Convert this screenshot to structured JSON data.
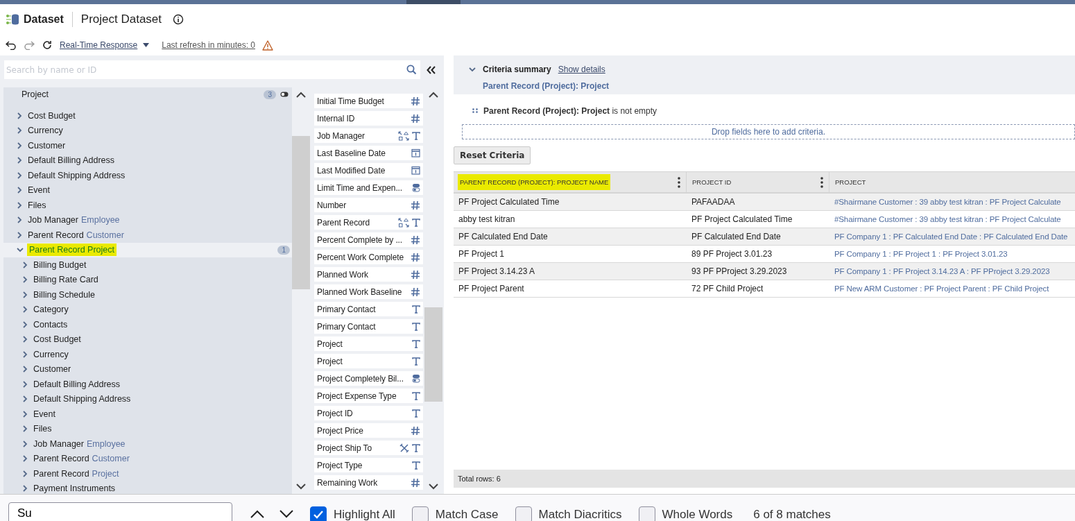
{
  "header": {
    "app": "Dataset",
    "title": "Project Dataset"
  },
  "toolbar": {
    "undo_disabled": false,
    "redo_disabled": true,
    "mode": "Real-Time Response",
    "refresh": "Last refresh in minutes: 0"
  },
  "search": {
    "placeholder": "Search by name or ID"
  },
  "tree": {
    "title": "Project",
    "count": "3",
    "items": [
      {
        "label": "Cost Budget",
        "expanded": false,
        "selected": false
      },
      {
        "label": "Currency",
        "expanded": false,
        "selected": false
      },
      {
        "label": "Customer",
        "expanded": false,
        "selected": false
      },
      {
        "label": "Default Billing Address",
        "expanded": false,
        "selected": false
      },
      {
        "label": "Default Shipping Address",
        "expanded": false,
        "selected": false
      },
      {
        "label": "Event",
        "expanded": false,
        "selected": false
      },
      {
        "label": "Files",
        "expanded": false,
        "selected": false
      },
      {
        "label": "Job Manager",
        "sublabel": "Employee",
        "expanded": false,
        "selected": false
      },
      {
        "label": "Parent Record",
        "sublabel": "Customer",
        "expanded": false,
        "selected": false
      },
      {
        "label": "Parent Record Project",
        "count": "1",
        "highlighted": true,
        "expanded": true,
        "selected": true,
        "children": [
          {
            "label": "Billing Budget",
            "expanded": false,
            "selected": false
          },
          {
            "label": "Billing Rate Card",
            "expanded": false,
            "selected": false
          },
          {
            "label": "Billing Schedule",
            "expanded": false,
            "selected": false
          },
          {
            "label": "Category",
            "expanded": false,
            "selected": false
          },
          {
            "label": "Contacts",
            "expanded": false,
            "selected": false
          },
          {
            "label": "Cost Budget",
            "expanded": false,
            "selected": false
          },
          {
            "label": "Currency",
            "expanded": false,
            "selected": false
          },
          {
            "label": "Customer",
            "expanded": false,
            "selected": false
          },
          {
            "label": "Default Billing Address",
            "expanded": false,
            "selected": false
          },
          {
            "label": "Default Shipping Address",
            "expanded": false,
            "selected": false
          },
          {
            "label": "Event",
            "expanded": false,
            "selected": false
          },
          {
            "label": "Files",
            "expanded": false,
            "selected": false
          },
          {
            "label": "Job Manager",
            "sublabel": "Employee",
            "expanded": false,
            "selected": false
          },
          {
            "label": "Parent Record",
            "sublabel": "Customer",
            "expanded": false,
            "selected": false
          },
          {
            "label": "Parent Record",
            "sublabel": "Project",
            "expanded": false,
            "selected": false
          },
          {
            "label": "Payment Instruments",
            "expanded": false,
            "selected": false
          }
        ]
      }
    ]
  },
  "fields": [
    {
      "label": "Initial Time Budget",
      "kind": "number"
    },
    {
      "label": "Internal ID",
      "kind": "number"
    },
    {
      "label": "Job Manager",
      "kind": "reference"
    },
    {
      "label": "Last Baseline Date",
      "kind": "date"
    },
    {
      "label": "Last Modified Date",
      "kind": "date"
    },
    {
      "label": "Limit Time and Expen...",
      "kind": "boolean"
    },
    {
      "label": "Number",
      "kind": "number"
    },
    {
      "label": "Parent Record",
      "kind": "reference"
    },
    {
      "label": "Percent Complete by ...",
      "kind": "number"
    },
    {
      "label": "Percent Work Complete",
      "kind": "number"
    },
    {
      "label": "Planned Work",
      "kind": "number"
    },
    {
      "label": "Planned Work Baseline",
      "kind": "number"
    },
    {
      "label": "Primary Contact",
      "kind": "text"
    },
    {
      "label": "Primary Contact",
      "kind": "text"
    },
    {
      "label": "Project",
      "kind": "text"
    },
    {
      "label": "Project",
      "kind": "text"
    },
    {
      "label": "Project Completely Bil...",
      "kind": "boolean"
    },
    {
      "label": "Project Expense Type",
      "kind": "text"
    },
    {
      "label": "Project ID",
      "kind": "text"
    },
    {
      "label": "Project Price",
      "kind": "number"
    },
    {
      "label": "Project Ship To",
      "kind": "address"
    },
    {
      "label": "Project Type",
      "kind": "text"
    },
    {
      "label": "Remaining Work",
      "kind": "number"
    }
  ],
  "criteria": {
    "title": "Criteria summary",
    "expanded": true,
    "details_link": "Show details",
    "summary": "Parent Record (Project): Project",
    "conditions": [
      "**Parent Record (Project): Project** is not empty"
    ],
    "drop_hint": "Drop fields here to add criteria.",
    "reset": "Reset Criteria"
  },
  "table": {
    "columns": [
      {
        "label": "PARENT RECORD (PROJECT): PROJECT NAME",
        "highlighted": true,
        "menu": true,
        "link": false
      },
      {
        "label": "PROJECT ID",
        "highlighted": false,
        "menu": true,
        "link": false
      },
      {
        "label": "PROJECT",
        "highlighted": false,
        "menu": false,
        "link": true
      }
    ],
    "rows": [
      [
        "PF Project Calculated Time",
        "PAFAADAA",
        "#Shairmane Customer : 39 abby test kitran : PF Project Calculate"
      ],
      [
        "abby test kitran",
        "PF Project Calculated Time",
        "#Shairmane Customer : 39 abby test kitran : PF Project Calculate"
      ],
      [
        "PF Calculated End Date",
        "PF Calculated End Date",
        "PF Company 1 : PF Calculated End Date : PF Calculated End Date"
      ],
      [
        "PF Project 1",
        "89 PF Project 3.01.23",
        "PF Company 1 : PF Project 1 : PF Project 3.01.23"
      ],
      [
        "PF Project 3.14.23 A",
        "93 PF PProject 3.29.2023",
        "PF Company 1 : PF Project 3.14.23 A : PF PProject 3.29.2023"
      ],
      [
        "PF Project Parent",
        "72 PF Child Project",
        "PF New ARM Customer : PF Project Parent : PF Child Project"
      ]
    ],
    "footer": "Total rows: 6"
  },
  "find_bar": {
    "value": "Su",
    "options": [
      {
        "label": "Highlight All",
        "checked": true
      },
      {
        "label": "Match Case",
        "checked": false
      },
      {
        "label": "Match Diacritics",
        "checked": false
      },
      {
        "label": "Whole Words",
        "checked": false
      }
    ],
    "status": "6 of 8 matches"
  }
}
